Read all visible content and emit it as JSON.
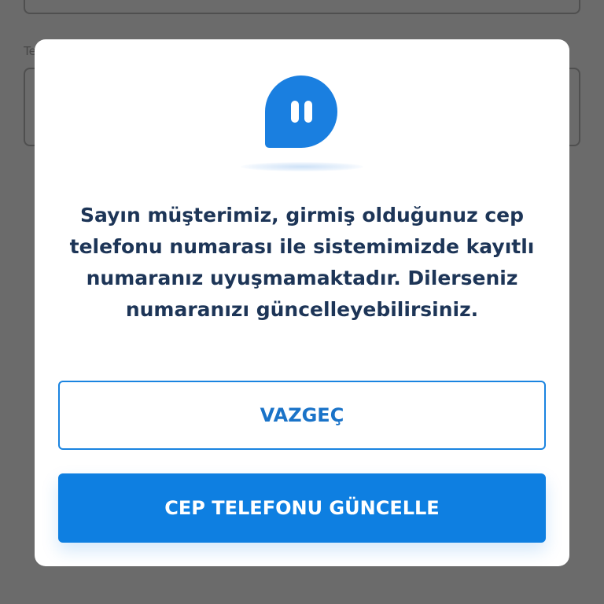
{
  "background": {
    "field_label": "Te"
  },
  "modal": {
    "icon": "chat-bubble-pause-icon",
    "message": "Sayın müşterimiz, girmiş olduğunuz cep telefonu numarası ile sistemimizde kayıtlı numaranız uyuşmamaktadır. Dilerseniz numaranızı güncelleyebilirsiniz.",
    "cancel_label": "VAZGEÇ",
    "update_label": "CEP TELEFONU GÜNCELLE"
  },
  "colors": {
    "primary": "#0e7fe1",
    "text": "#1d3557",
    "overlay": "#6b6b6b"
  }
}
